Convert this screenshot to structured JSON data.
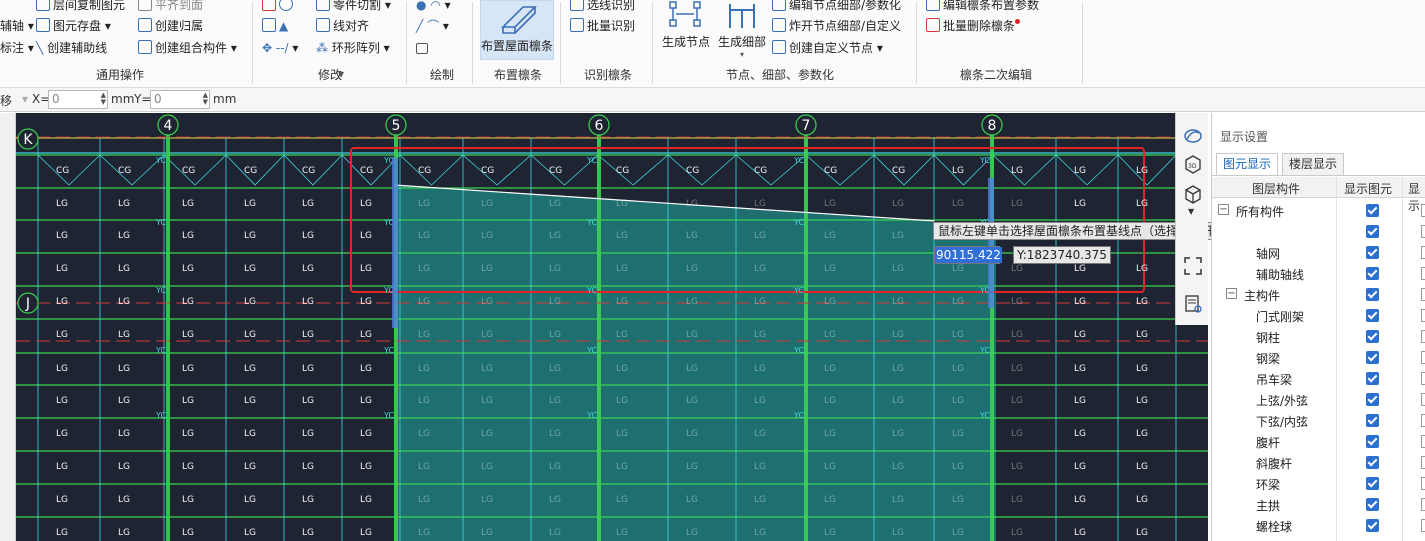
{
  "ribbon": {
    "left_col": [
      "辅轴",
      "标注"
    ],
    "col1": [
      "层间复制图元",
      "图元存盘",
      "创建辅助线"
    ],
    "col2": [
      "平齐到面",
      "创建归属",
      "创建组合构件"
    ],
    "group1_label": "通用操作",
    "col3": [
      "零件切割",
      "线对齐",
      "环形阵列"
    ],
    "group2_label": "修改",
    "group3_label": "绘制",
    "big_purlin": "布置屋面檩条",
    "group4_label": "布置檩条",
    "col4": [
      "选线识别",
      "批量识别"
    ],
    "group5_label": "识别檩条",
    "big_node": "生成节点",
    "big_detail": "生成细部",
    "col5": [
      "编辑节点细部/参数化",
      "炸开节点细部/自定义",
      "创建自定义节点"
    ],
    "group6_label": "节点、细部、参数化",
    "col6": [
      "编辑檩条布置参数",
      "批量删除檩条"
    ],
    "group7_label": "檩条二次编辑"
  },
  "coordbar": {
    "mode": "移",
    "x_label": "X=",
    "x_value": "0",
    "x_unit": "mm",
    "y_label": "Y=",
    "y_value": "0",
    "y_unit": "mm"
  },
  "canvas": {
    "axis_labels": [
      "K",
      "J",
      "4",
      "5",
      "6",
      "7",
      "8"
    ],
    "member_labels": [
      "LG",
      "CG",
      "YC"
    ],
    "tooltip": "鼠标左键单击选择屋面檩条布置基线点（选择梁或杆件标高较低的一端），按右键或ESC取消",
    "x_input": "90115.422",
    "y_readout": "Y:1823740.375"
  },
  "panel": {
    "title": "显示设置",
    "tabs": [
      "图元显示",
      "楼层显示"
    ],
    "columns": [
      "图层构件",
      "显示图元",
      "显示"
    ],
    "rows": [
      {
        "label": "所有构件",
        "level": 0,
        "tree": "−"
      },
      {
        "label": "",
        "level": 1,
        "tree": ""
      },
      {
        "label": "轴网",
        "level": 2,
        "tree": ""
      },
      {
        "label": "辅助轴线",
        "level": 2,
        "tree": ""
      },
      {
        "label": "主构件",
        "level": 1,
        "tree": "−"
      },
      {
        "label": "门式刚架",
        "level": 2,
        "tree": ""
      },
      {
        "label": "钢柱",
        "level": 2,
        "tree": ""
      },
      {
        "label": "钢梁",
        "level": 2,
        "tree": ""
      },
      {
        "label": "吊车梁",
        "level": 2,
        "tree": ""
      },
      {
        "label": "上弦/外弦",
        "level": 2,
        "tree": ""
      },
      {
        "label": "下弦/内弦",
        "level": 2,
        "tree": ""
      },
      {
        "label": "腹杆",
        "level": 2,
        "tree": ""
      },
      {
        "label": "斜腹杆",
        "level": 2,
        "tree": ""
      },
      {
        "label": "环梁",
        "level": 2,
        "tree": ""
      },
      {
        "label": "主拱",
        "level": 2,
        "tree": ""
      },
      {
        "label": "螺栓球",
        "level": 2,
        "tree": ""
      }
    ]
  },
  "colors": {
    "canvas_bg": "#1f2433",
    "grid_green": "#3bd14f",
    "cyan": "#3fd6e0",
    "axis_red": "#d23a3a",
    "selection_red": "#e0242a",
    "teal_fill": "#1f8a86",
    "accent_blue": "#2b6fd0"
  }
}
